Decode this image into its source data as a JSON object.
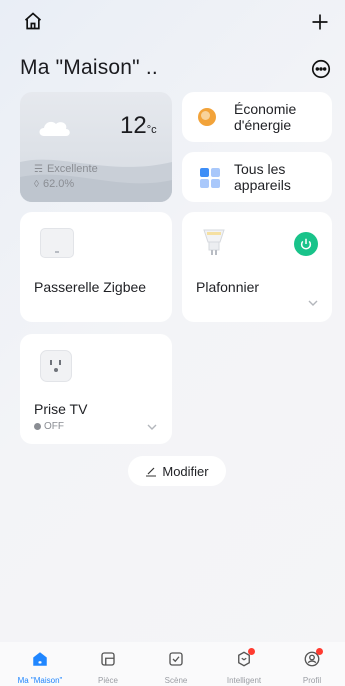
{
  "header": {
    "title": "Ma \"Maison\" .."
  },
  "weather": {
    "temp": "12",
    "unit": "°c",
    "air_quality": "Excellente",
    "humidity": "62.0%"
  },
  "shortcuts": [
    {
      "label": "Économie\nd'énergie",
      "icon": "energy-icon"
    },
    {
      "label": "Tous les\nappareils",
      "icon": "grid-icon"
    }
  ],
  "devices": [
    {
      "name": "Passerelle Zigbee",
      "icon": "gateway-icon"
    },
    {
      "name": "Plafonnier",
      "icon": "bulb-icon",
      "power": "on"
    },
    {
      "name": "Prise TV",
      "icon": "outlet-icon",
      "status": "OFF"
    }
  ],
  "modify_button": "Modifier",
  "nav": [
    {
      "label": "Ma \"Maison\"",
      "icon": "home-icon",
      "active": true
    },
    {
      "label": "Pièce",
      "icon": "room-icon"
    },
    {
      "label": "Scène",
      "icon": "scene-icon"
    },
    {
      "label": "Intelligent",
      "icon": "smart-icon",
      "badge": true
    },
    {
      "label": "Profil",
      "icon": "profile-icon",
      "badge": true
    }
  ],
  "colors": {
    "accent": "#1f86ff",
    "power_on": "#19c38a",
    "energy": "#f2a33a"
  }
}
